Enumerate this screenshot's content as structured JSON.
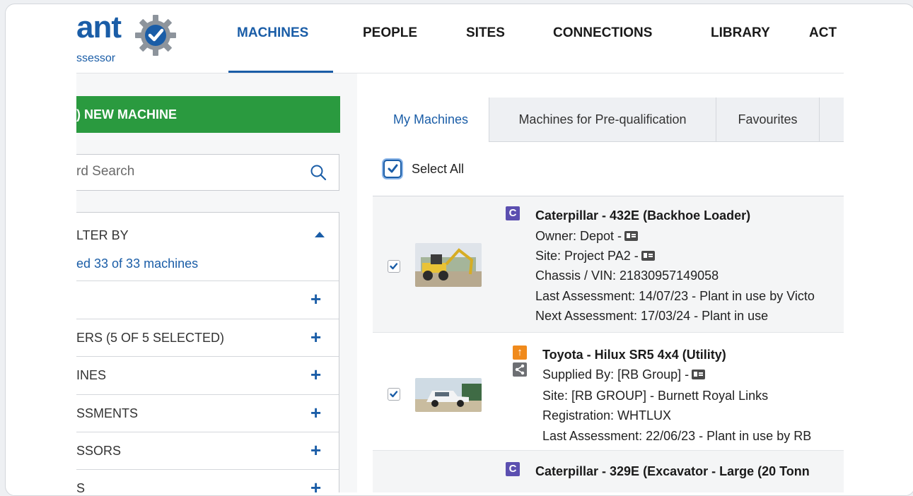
{
  "header": {
    "logo_text": "ant",
    "logo_sub": "ssessor",
    "nav": [
      {
        "label": "MACHINES",
        "active": true
      },
      {
        "label": "PEOPLE"
      },
      {
        "label": "SITES"
      },
      {
        "label": "CONNECTIONS"
      },
      {
        "label": "LIBRARY"
      },
      {
        "label": "ACT"
      }
    ]
  },
  "sidebar": {
    "add_button": ") NEW MACHINE",
    "search_placeholder": "rd Search",
    "filter_title": "LTER BY",
    "filter_count": "ed 33 of 33 machines",
    "filters": [
      {
        "label": ""
      },
      {
        "label": "ERS (5 OF 5 SELECTED)"
      },
      {
        "label": "INES"
      },
      {
        "label": "SSMENTS"
      },
      {
        "label": "SSORS"
      },
      {
        "label": "S"
      }
    ]
  },
  "tabs": [
    {
      "label": "My Machines",
      "active": true
    },
    {
      "label": "Machines for Pre-qualification"
    },
    {
      "label": "Favourites"
    }
  ],
  "select_all": {
    "label": "Select All",
    "checked": true
  },
  "machines": [
    {
      "badge": "C",
      "title": "Caterpillar - 432E (Backhoe Loader)",
      "lines": [
        "Owner: Depot -",
        "Site: Project PA2 -",
        "Chassis / VIN: 21830957149058",
        "Last Assessment: 14/07/23 - Plant in use by Victo",
        "Next Assessment: 17/03/24 - Plant in use"
      ],
      "checked": true
    },
    {
      "badge": "↑",
      "title": "Toyota - Hilux SR5 4x4 (Utility)",
      "lines": [
        "Supplied By: [RB Group] -",
        "Site: [RB GROUP] - Burnett Royal Links",
        "Registration: WHTLUX",
        "Last Assessment: 22/06/23 - Plant in use by RB"
      ],
      "checked": true
    },
    {
      "badge": "C",
      "title": "Caterpillar - 329E (Excavator - Large (20 Tonn"
    }
  ],
  "colors": {
    "brand_blue": "#1a5da7",
    "add_green": "#2a9a3f",
    "badge_purple": "#5b4fb0",
    "badge_orange": "#f08a1c"
  }
}
